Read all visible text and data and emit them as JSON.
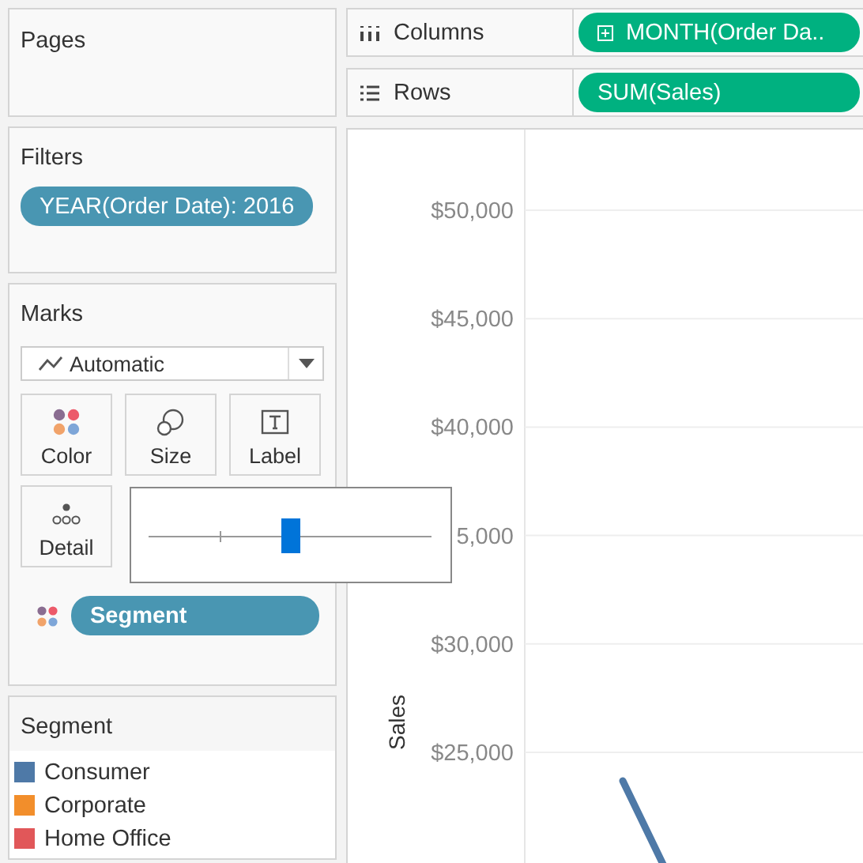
{
  "pages": {
    "title": "Pages"
  },
  "shelves": [
    {
      "kind": "columns",
      "label": "Columns",
      "pill": {
        "text": "MONTH(Order Da..",
        "expandable": true
      }
    },
    {
      "kind": "rows",
      "label": "Rows",
      "pill": {
        "text": "SUM(Sales)",
        "expandable": false
      }
    }
  ],
  "filters": {
    "title": "Filters",
    "pills": [
      "YEAR(Order Date): 2016"
    ]
  },
  "marks": {
    "title": "Marks",
    "type": "Automatic",
    "cards": [
      {
        "kind": "color",
        "label": "Color"
      },
      {
        "kind": "size",
        "label": "Size"
      },
      {
        "kind": "label",
        "label": "Label"
      },
      {
        "kind": "detail",
        "label": "Detail"
      }
    ],
    "pills": [
      {
        "kind": "color",
        "text": "Segment"
      }
    ],
    "size_popup": {
      "level": 0.5
    }
  },
  "legend": {
    "title": "Segment",
    "items": [
      {
        "label": "Consumer",
        "color": "#4e79a7"
      },
      {
        "label": "Corporate",
        "color": "#f28e2b"
      },
      {
        "label": "Home Office",
        "color": "#e15759"
      }
    ]
  },
  "chart": {
    "axis_title": "Sales",
    "tick_labels": [
      "$50,000",
      "$45,000",
      "$40,000",
      "5,000",
      "$30,000",
      "$25,000"
    ]
  }
}
